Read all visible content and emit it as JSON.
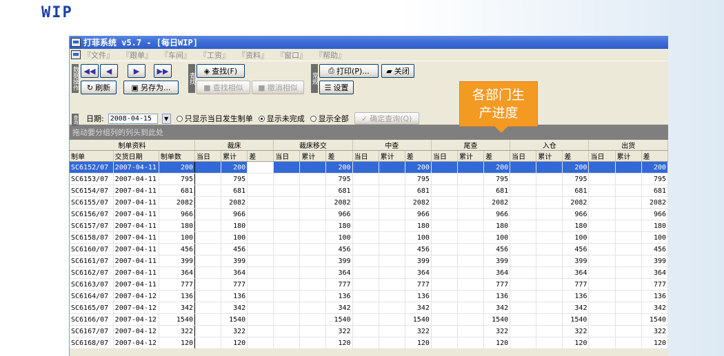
{
  "slide": {
    "title": "WIP"
  },
  "window": {
    "title": "打菲系统 v5.7 - [每日WIP]"
  },
  "menu": [
    "『文件』",
    "『跟单』",
    "『车间』",
    "『工资』",
    "『资料』",
    "『窗口』",
    "『帮助』"
  ],
  "toolbar": {
    "tab_data_ops": "数据操作",
    "tab_find": "查找",
    "tab_general": "常规",
    "tab_query": "查询",
    "first": "◀◀",
    "prev": "◀",
    "next": "▶",
    "last": "▶▶",
    "refresh": "刷新",
    "save_as": "另存为...",
    "find": "查找(F)",
    "find_similar": "查找相似",
    "cancel_similar": "撤消相似",
    "print": "打印(P)...",
    "close": "关闭",
    "settings": "设置"
  },
  "filter": {
    "date_label": "日期:",
    "date_value": "2008-04-15",
    "radio_only_today": "只显示当日发生制单",
    "radio_incomplete": "显示未完成",
    "radio_all": "显示全部",
    "confirm_query": "确定查询(Q)",
    "selected_radio": "incomplete"
  },
  "callout": {
    "line1": "各部门生",
    "line2": "产进度"
  },
  "grid": {
    "group_hint": "拖动要分组列的列头到此处",
    "groups": [
      "制单资料",
      "裁床",
      "裁床移交",
      "中查",
      "尾查",
      "入仓",
      "出货"
    ],
    "columns": [
      "制单",
      "交货日期",
      "制单数",
      "当日",
      "累计",
      "差",
      "当日",
      "累计",
      "差",
      "当日",
      "累计",
      "差",
      "当日",
      "累计",
      "差",
      "当日",
      "累计",
      "差",
      "当日",
      "累计",
      "差"
    ],
    "rows": [
      [
        "SC6152/07",
        "2007-04-11",
        "200"
      ],
      [
        "SC6153/07",
        "2007-04-11",
        "795"
      ],
      [
        "SC6154/07",
        "2007-04-11",
        "681"
      ],
      [
        "SC6155/07",
        "2007-04-11",
        "2082"
      ],
      [
        "SC6156/07",
        "2007-04-11",
        "966"
      ],
      [
        "SC6157/07",
        "2007-04-11",
        "180"
      ],
      [
        "SC6158/07",
        "2007-04-11",
        "100"
      ],
      [
        "SC6160/07",
        "2007-04-11",
        "456"
      ],
      [
        "SC6161/07",
        "2007-04-11",
        "399"
      ],
      [
        "SC6162/07",
        "2007-04-11",
        "364"
      ],
      [
        "SC6163/07",
        "2007-04-11",
        "777"
      ],
      [
        "SC6164/07",
        "2007-04-12",
        "136"
      ],
      [
        "SC6165/07",
        "2007-04-12",
        "342"
      ],
      [
        "SC6166/07",
        "2007-04-12",
        "1540"
      ],
      [
        "SC6167/07",
        "2007-04-12",
        "322"
      ],
      [
        "SC6168/07",
        "2007-04-12",
        "120"
      ]
    ]
  }
}
